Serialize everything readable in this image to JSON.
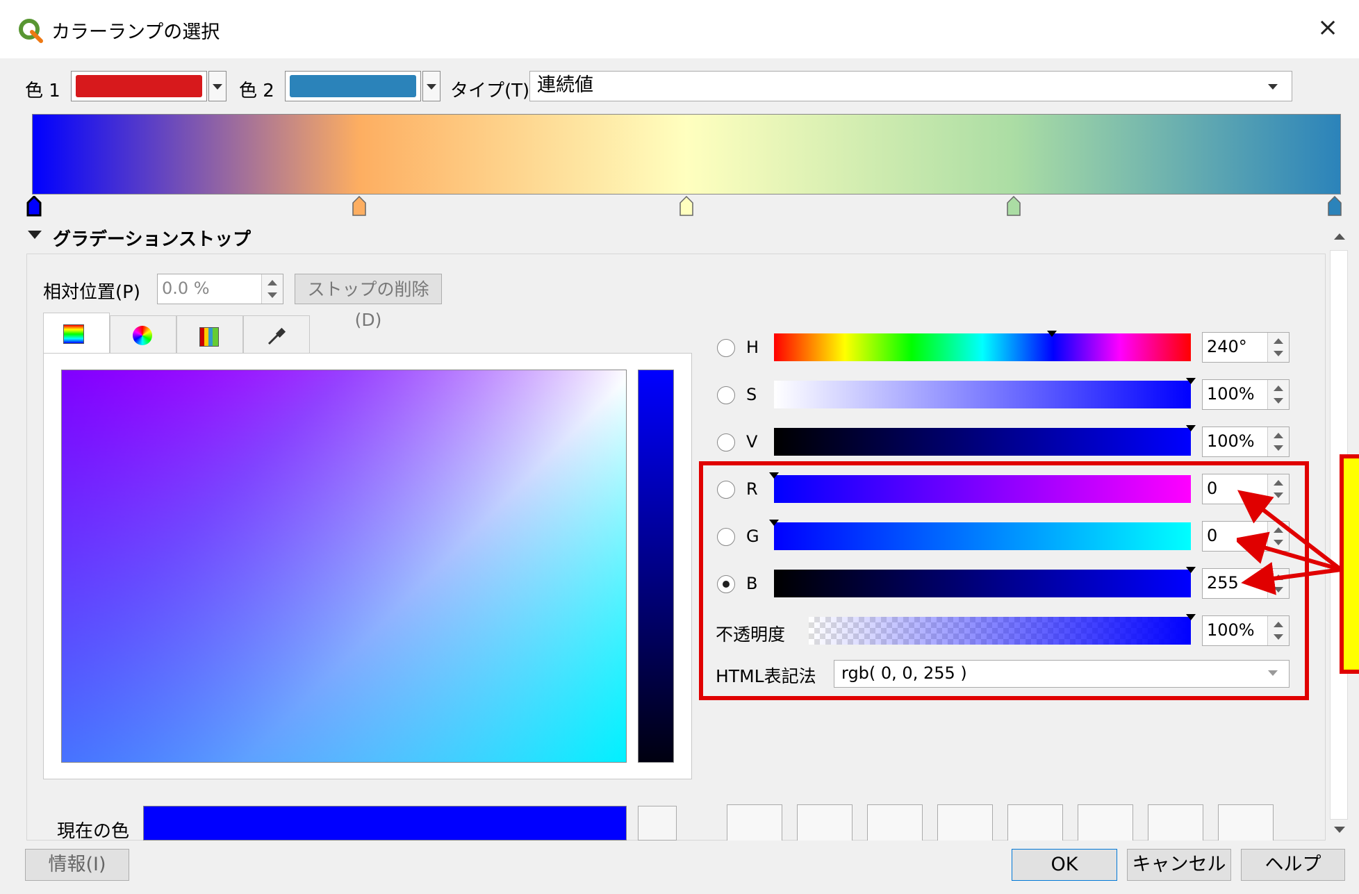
{
  "window": {
    "title": "カラーランプの選択",
    "close_symbol": "×"
  },
  "toolbar": {
    "color1_label": "色 1",
    "color1_value": "#d7191c",
    "color2_label": "色 2",
    "color2_value": "#2b83ba",
    "type_label": "タイプ(T)",
    "type_value": "連続値"
  },
  "ramp": {
    "stops": [
      {
        "position": 0.0,
        "color": "#0000ff"
      },
      {
        "position": 0.25,
        "color": "#fdae61"
      },
      {
        "position": 0.5,
        "color": "#ffffbf"
      },
      {
        "position": 0.75,
        "color": "#abdda4"
      },
      {
        "position": 1.0,
        "color": "#2b83ba"
      }
    ]
  },
  "gradient_section": {
    "title": "グラデーションストップ",
    "relative_position_label": "相対位置(P)",
    "relative_position_value": "0.0 %",
    "delete_stop_label": "ストップの削除(D)"
  },
  "color_tabs": [
    "ramp-tab-icon",
    "wheel-tab-icon",
    "swatch-grid-tab-icon",
    "eyedropper-tab-icon"
  ],
  "channels": {
    "h": {
      "label": "H",
      "value": "240°",
      "level": 0.667
    },
    "s": {
      "label": "S",
      "value": "100%",
      "level": 1.0
    },
    "v": {
      "label": "V",
      "value": "100%",
      "level": 1.0
    },
    "r": {
      "label": "R",
      "value": "0",
      "level": 0.0
    },
    "g": {
      "label": "G",
      "value": "0",
      "level": 0.0
    },
    "b": {
      "label": "B",
      "value": "255",
      "level": 1.0
    },
    "opacity": {
      "label": "不透明度",
      "value": "100%",
      "level": 1.0
    }
  },
  "html_notation": {
    "label": "HTML表記法",
    "value": "rgb( 0, 0, 255 )"
  },
  "current_color": {
    "label": "現在の色",
    "value": "#0000ff"
  },
  "footer": {
    "info_label": "情報(I)",
    "ok_label": "OK",
    "cancel_label": "キャンセル",
    "help_label": "ヘルプ"
  },
  "colors": {
    "accent_red": "#e00000",
    "note_bg": "#ffff00"
  }
}
